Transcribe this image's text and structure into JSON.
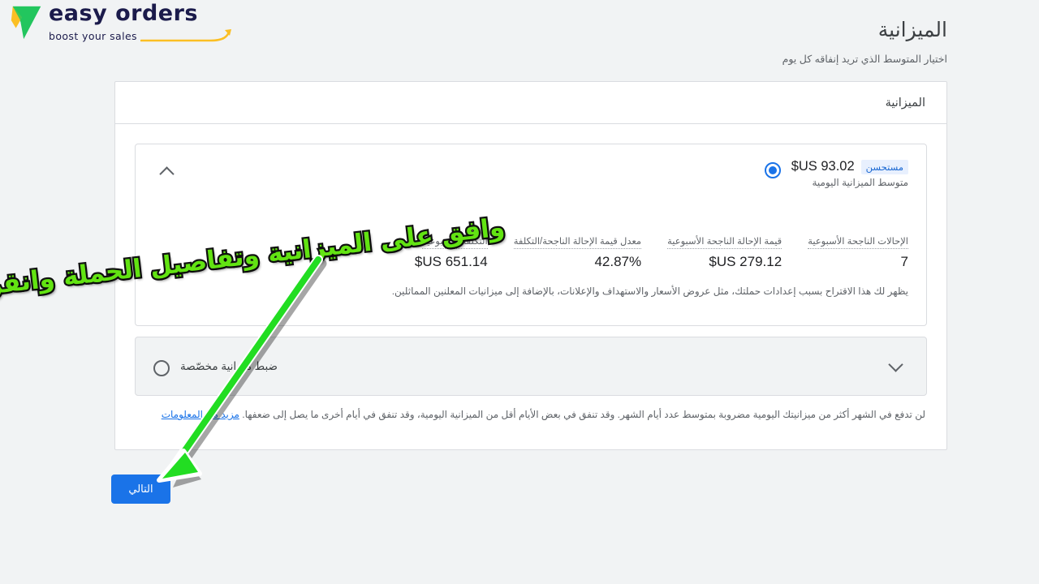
{
  "brand": {
    "name": "easy orders",
    "tagline": "boost your sales"
  },
  "header": {
    "title": "الميزانية",
    "subtitle": "اختيار المتوسط الذي تريد إنفاقه كل يوم"
  },
  "card": {
    "header_title": "الميزانية"
  },
  "recommended_option": {
    "amount": "$US 93.02",
    "badge": "مستحسن",
    "sub_label": "متوسط الميزانية اليومية",
    "note": "يظهر لك هذا الاقتراح بسبب إعدادات حملتك، مثل عروض الأسعار والاستهداف والإعلانات، بالإضافة إلى ميزانيات المعلنين المماثلين.",
    "stats": [
      {
        "label": "الإحالات الناجحة الأسبوعية",
        "value": "7"
      },
      {
        "label": "قيمة الإحالة الناجحة الأسبوعية",
        "value": "$US 279.12"
      },
      {
        "label": "معدل قيمة الإحالة الناجحة/التكلفة",
        "value": "42.87%"
      },
      {
        "label": "التكلفة الأسبوعية",
        "value": "$US 651.14"
      }
    ]
  },
  "custom_option": {
    "label": "ضبط ميزانية مخصّصة"
  },
  "footer": {
    "note": "لن تدفع في الشهر أكثر من ميزانيتك اليومية مضروبة بمتوسط عدد أيام الشهر. وقد تنفق في بعض الأيام أقل من الميزانية اليومية، وقد تنفق في أيام أخرى ما يصل إلى ضعفها.",
    "link": "مزيد من المعلومات"
  },
  "actions": {
    "next": "التالي"
  },
  "annotation": {
    "text": "وافق على الميزانية وتفاصيل الحملة وانقر هنا",
    "color": "#62e312",
    "outline_color": "#111111",
    "arrow_color": "#22dd22"
  },
  "colors": {
    "accent": "#1a73e8",
    "page_bg": "#f1f3f4",
    "badge_bg": "#e8f0fe",
    "badge_text": "#1967d2"
  }
}
